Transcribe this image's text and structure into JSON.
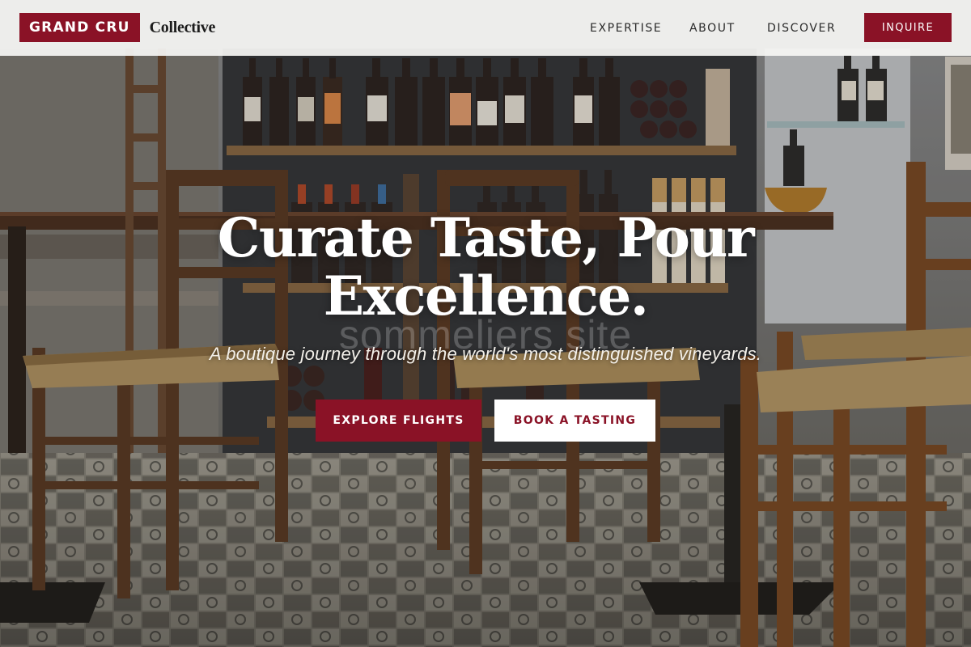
{
  "brand": {
    "name": "GRAND CRU",
    "sub": "Collective",
    "accent_color": "#8a1226"
  },
  "nav": {
    "items": [
      "EXPERTISE",
      "ABOUT",
      "DISCOVER"
    ],
    "cta": "INQUIRE"
  },
  "hero": {
    "title_line1": "Curate Taste, Pour",
    "title_line2": "Excellence.",
    "watermark": "sommeliers site",
    "subtitle": "A boutique journey through the world's most distinguished vineyards.",
    "primary_button": "EXPLORE FLIGHTS",
    "secondary_button": "BOOK A TASTING",
    "background_description_icon": "wine-bar-photo"
  }
}
